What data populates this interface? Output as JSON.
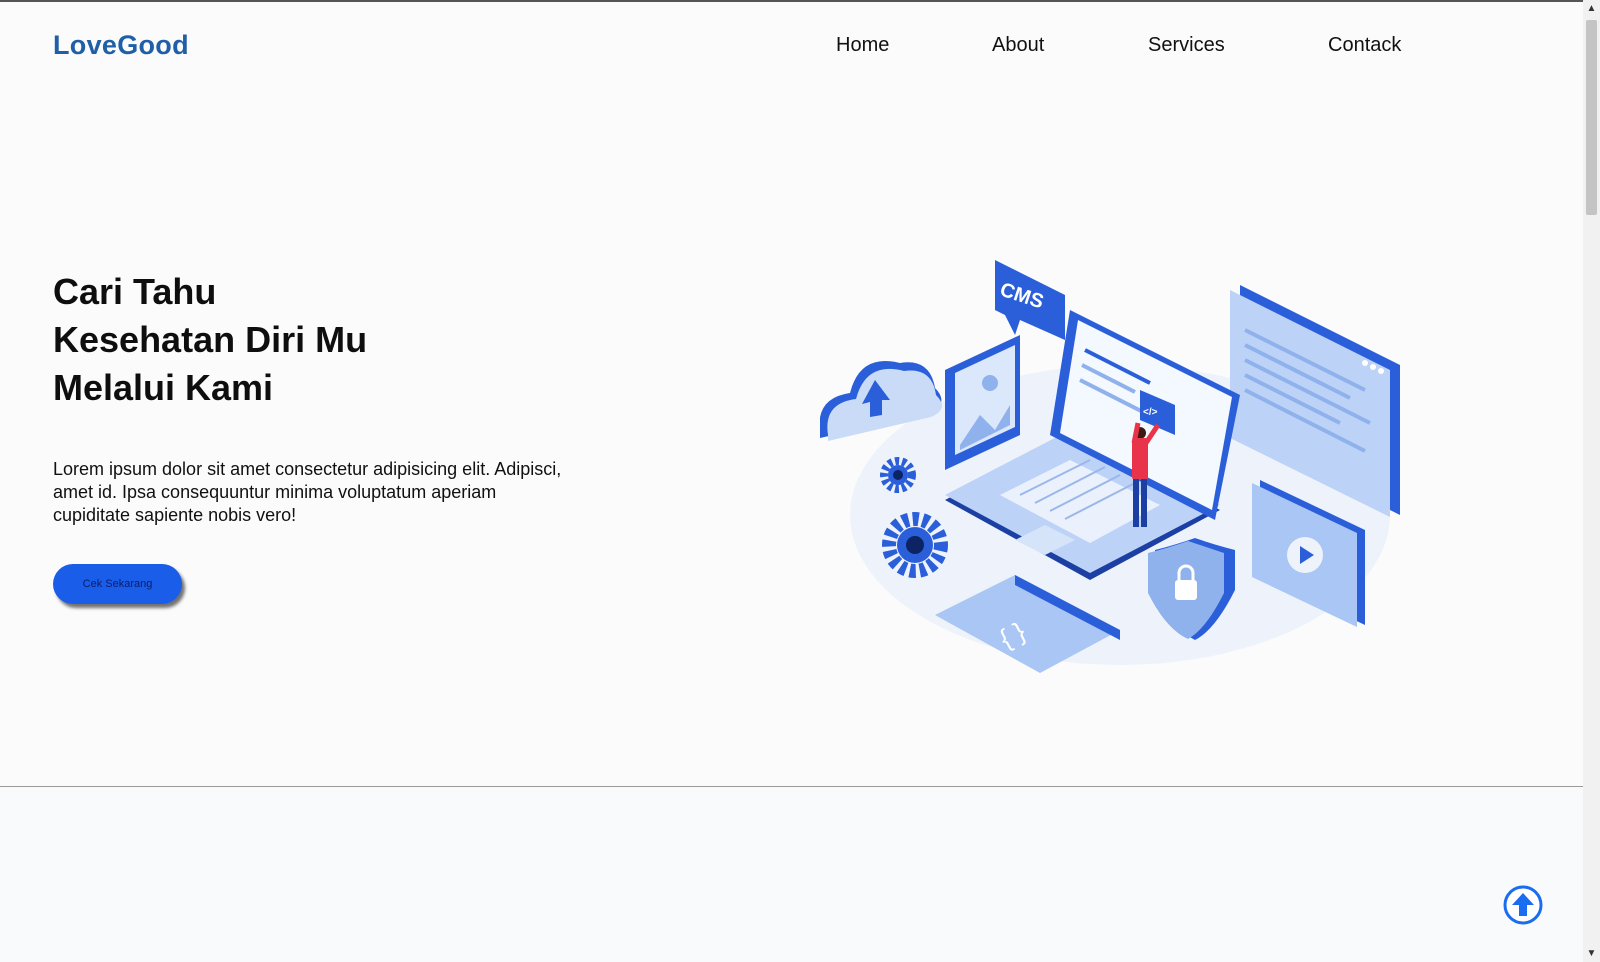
{
  "brand": {
    "logo": "LoveGood"
  },
  "nav": {
    "items": [
      {
        "label": "Home"
      },
      {
        "label": "About"
      },
      {
        "label": "Services"
      },
      {
        "label": "Contack"
      }
    ]
  },
  "hero": {
    "title_lines": [
      "Cari Tahu",
      "Kesehatan Diri Mu",
      "Melalui Kami"
    ],
    "description": "Lorem ipsum dolor sit amet consectetur adipisicing elit. Adipisci, amet id. Ipsa consequuntur minima voluptatum aperiam cupiditate sapiente nobis vero!",
    "cta_label": "Cek Sekarang",
    "illustration": {
      "cms_badge": "CMS",
      "code_tag": "</>"
    }
  },
  "icons": {
    "scroll_top": "arrow-up-circle-icon",
    "scroll_up": "chevron-up-icon",
    "scroll_down": "chevron-down-icon"
  },
  "colors": {
    "brand": "#1f5fa7",
    "accent": "#1a5de8",
    "illustration_blue": "#2b5fd9",
    "illustration_light": "#a9c6f4"
  }
}
